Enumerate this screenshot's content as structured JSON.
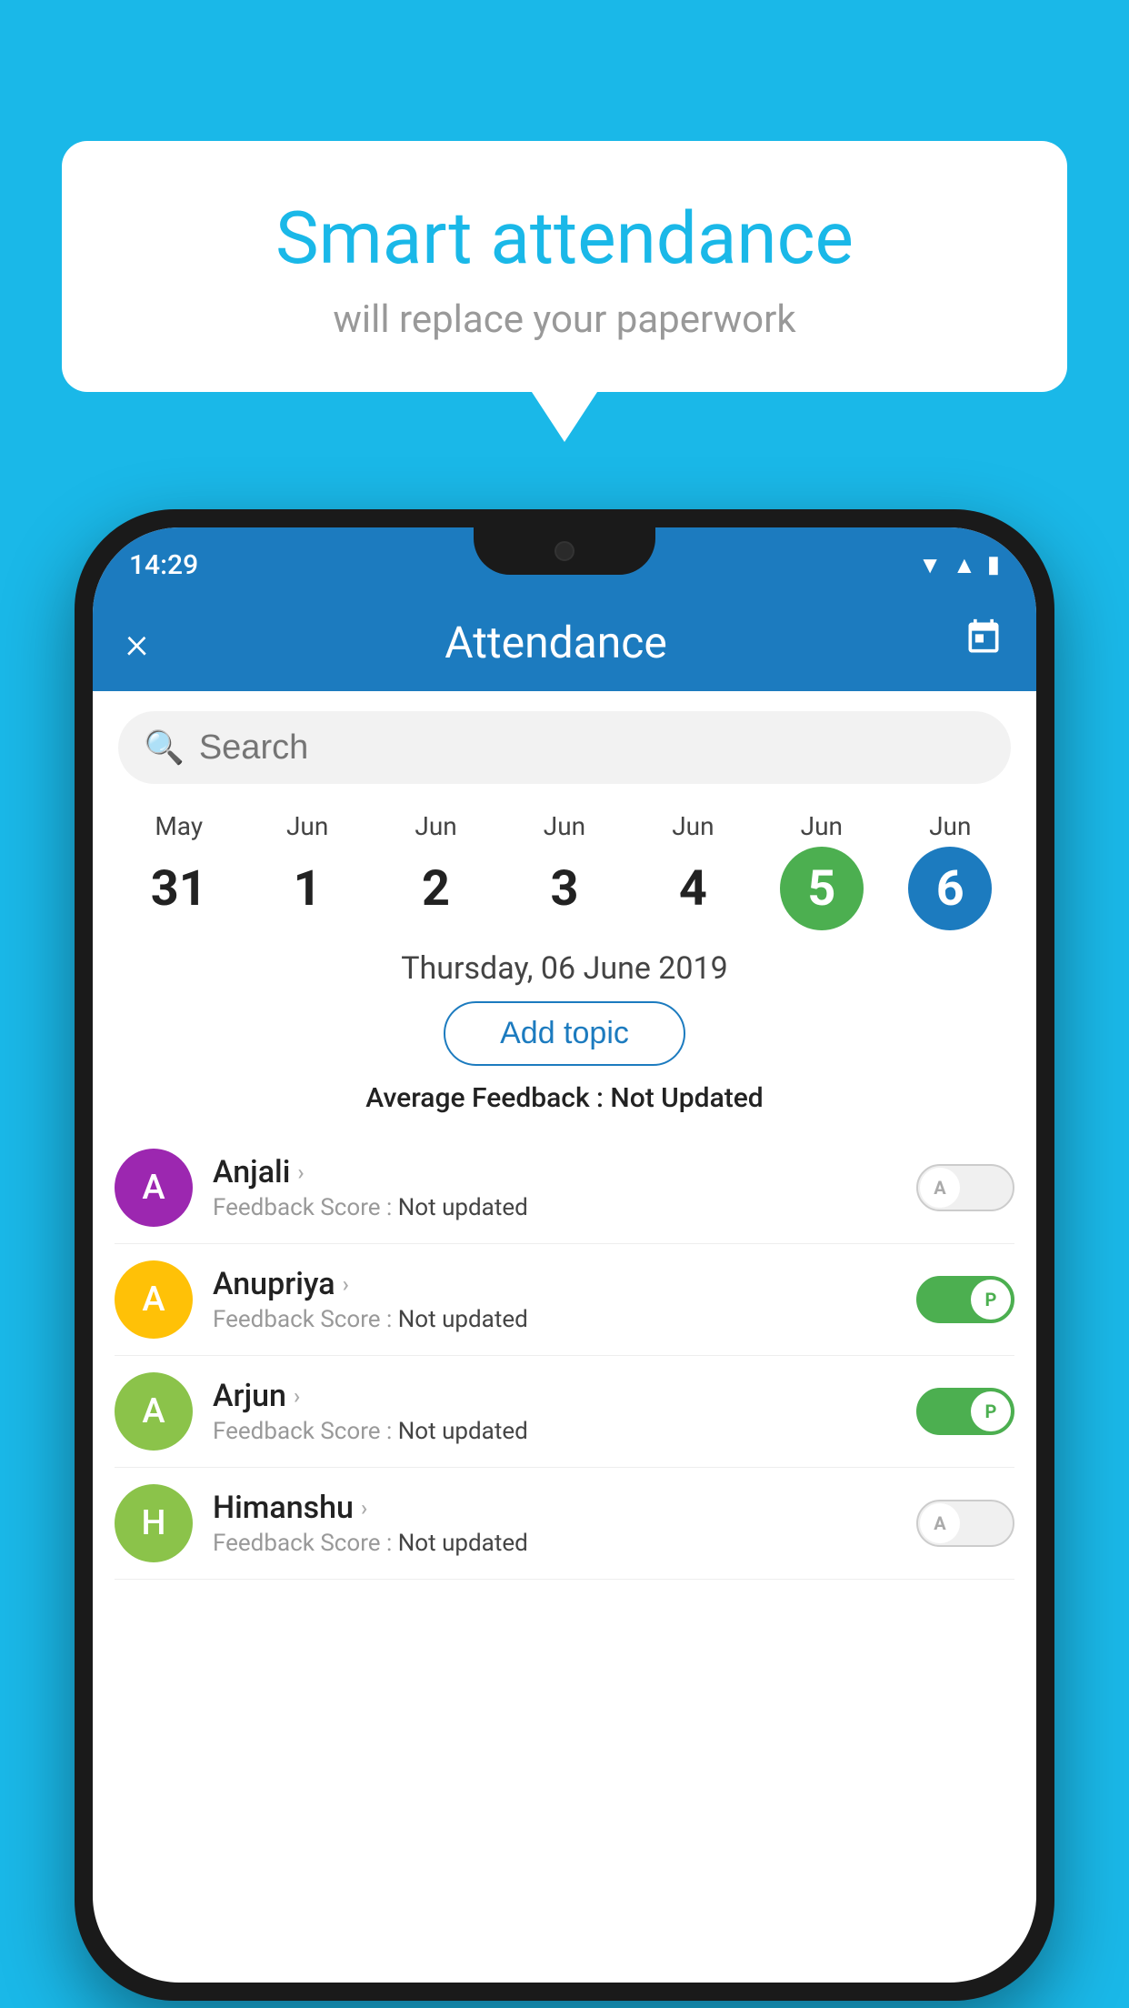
{
  "background_color": "#1ab8e8",
  "bubble": {
    "title": "Smart attendance",
    "subtitle": "will replace your paperwork"
  },
  "phone": {
    "status_bar": {
      "time": "14:29"
    },
    "header": {
      "title": "Attendance",
      "close_label": "×",
      "calendar_icon": "calendar-icon"
    },
    "search": {
      "placeholder": "Search"
    },
    "calendar": {
      "items": [
        {
          "month": "May",
          "day": "31",
          "style": "normal"
        },
        {
          "month": "Jun",
          "day": "1",
          "style": "normal"
        },
        {
          "month": "Jun",
          "day": "2",
          "style": "normal"
        },
        {
          "month": "Jun",
          "day": "3",
          "style": "normal"
        },
        {
          "month": "Jun",
          "day": "4",
          "style": "normal"
        },
        {
          "month": "Jun",
          "day": "5",
          "style": "selected-green"
        },
        {
          "month": "Jun",
          "day": "6",
          "style": "selected-blue"
        }
      ]
    },
    "selected_date": "Thursday, 06 June 2019",
    "add_topic_label": "Add topic",
    "avg_feedback_label": "Average Feedback : ",
    "avg_feedback_value": "Not Updated",
    "students": [
      {
        "name": "Anjali",
        "avatar_letter": "A",
        "avatar_color": "#9c27b0",
        "feedback_label": "Feedback Score : ",
        "feedback_value": "Not updated",
        "toggle": "off",
        "toggle_letter": "A"
      },
      {
        "name": "Anupriya",
        "avatar_letter": "A",
        "avatar_color": "#ffc107",
        "feedback_label": "Feedback Score : ",
        "feedback_value": "Not updated",
        "toggle": "on",
        "toggle_letter": "P"
      },
      {
        "name": "Arjun",
        "avatar_letter": "A",
        "avatar_color": "#8bc34a",
        "feedback_label": "Feedback Score : ",
        "feedback_value": "Not updated",
        "toggle": "on",
        "toggle_letter": "P"
      },
      {
        "name": "Himanshu",
        "avatar_letter": "H",
        "avatar_color": "#8bc34a",
        "feedback_label": "Feedback Score : ",
        "feedback_value": "Not updated",
        "toggle": "off",
        "toggle_letter": "A"
      }
    ]
  }
}
